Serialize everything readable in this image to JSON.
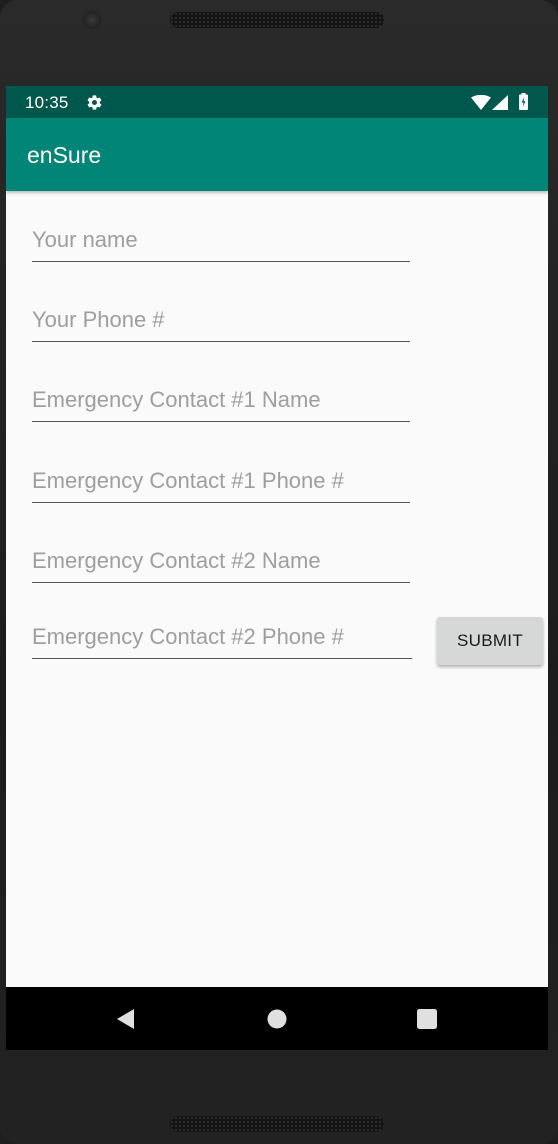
{
  "status_bar": {
    "time": "10:35",
    "icons": [
      "gear-icon",
      "wifi-icon",
      "signal-icon",
      "battery-icon"
    ],
    "color": "#00574b"
  },
  "app_bar": {
    "title": "enSure",
    "color": "#008577"
  },
  "form": {
    "fields": [
      {
        "placeholder": "Your name",
        "value": ""
      },
      {
        "placeholder": "Your Phone #",
        "value": ""
      },
      {
        "placeholder": "Emergency Contact #1 Name",
        "value": ""
      },
      {
        "placeholder": "Emergency Contact #1 Phone #",
        "value": ""
      },
      {
        "placeholder": "Emergency Contact #2 Name",
        "value": ""
      },
      {
        "placeholder": "Emergency Contact #2 Phone #",
        "value": ""
      }
    ],
    "submit_label": "SUBMIT"
  },
  "nav_bar": {
    "icons": [
      "back-icon",
      "home-icon",
      "recents-icon"
    ]
  }
}
